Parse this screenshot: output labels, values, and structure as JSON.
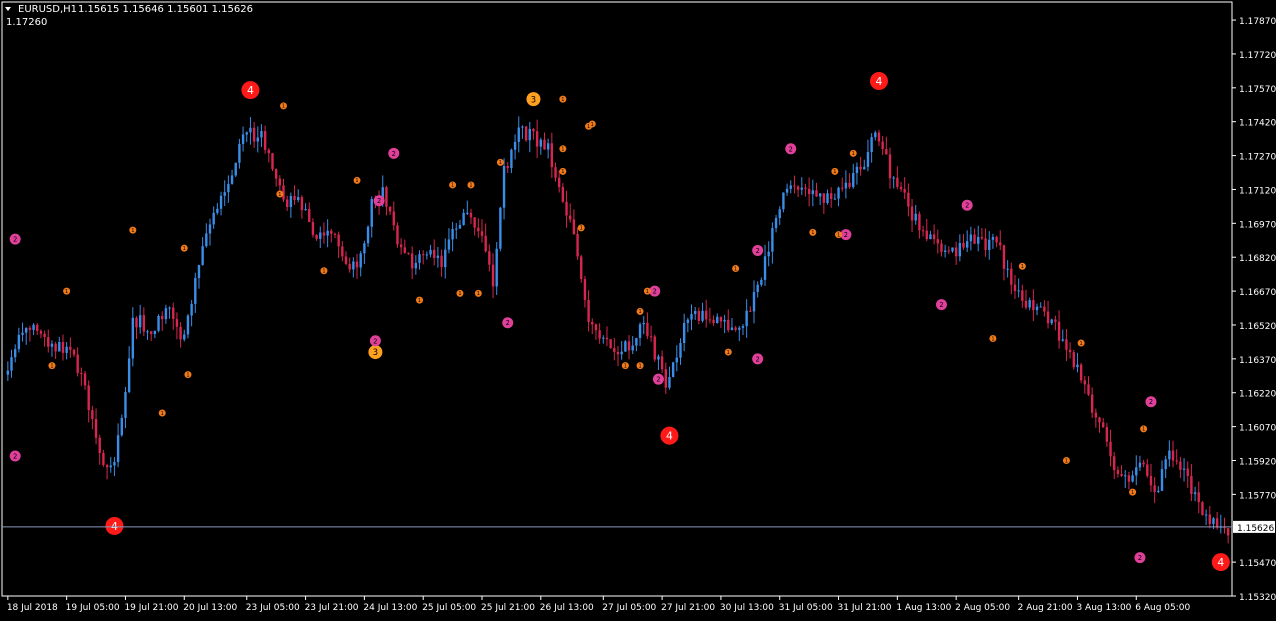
{
  "header": {
    "symbol": "EURUSD,H1",
    "ohlc": "1.15615 1.15646 1.15601 1.15626",
    "indicator_value": "1.17260",
    "menu_icon": "triangle-down-icon"
  },
  "colors": {
    "background": "#000000",
    "bull": "#3b8ee8",
    "bear": "#d7264f",
    "axis": "#ffffff",
    "bid_line": "#8899bb",
    "level4": "#ff1a1a",
    "level3": "#ffa020",
    "level2": "#e0409a",
    "level1": "#f07a1a"
  },
  "price_axis": {
    "labels": [
      "1.17870",
      "1.17720",
      "1.17570",
      "1.17420",
      "1.17270",
      "1.17120",
      "1.16970",
      "1.16820",
      "1.16670",
      "1.16520",
      "1.16370",
      "1.16220",
      "1.16070",
      "1.15920",
      "1.15770",
      "1.15626",
      "1.15470",
      "1.15320"
    ],
    "current_price": "1.15626"
  },
  "time_axis": {
    "labels": [
      "18 Jul 2018",
      "19 Jul 05:00",
      "19 Jul 21:00",
      "20 Jul 13:00",
      "23 Jul 05:00",
      "23 Jul 21:00",
      "24 Jul 13:00",
      "25 Jul 05:00",
      "25 Jul 21:00",
      "26 Jul 13:00",
      "27 Jul 05:00",
      "27 Jul 21:00",
      "30 Jul 13:00",
      "31 Jul 05:00",
      "31 Jul 21:00",
      "1 Aug 13:00",
      "2 Aug 05:00",
      "2 Aug 21:00",
      "3 Aug 13:00",
      "6 Aug 05:00"
    ]
  },
  "chart_data": {
    "type": "candlestick",
    "symbol": "EURUSD",
    "timeframe": "H1",
    "ylim": [
      1.1532,
      1.1795
    ],
    "anchors": [
      [
        0,
        1.163
      ],
      [
        5,
        1.1652
      ],
      [
        9,
        1.165
      ],
      [
        14,
        1.1642
      ],
      [
        18,
        1.1643
      ],
      [
        22,
        1.1625
      ],
      [
        26,
        1.1596
      ],
      [
        29,
        1.1587
      ],
      [
        32,
        1.161
      ],
      [
        35,
        1.1655
      ],
      [
        40,
        1.165
      ],
      [
        44,
        1.166
      ],
      [
        48,
        1.1645
      ],
      [
        52,
        1.167
      ],
      [
        56,
        1.17
      ],
      [
        60,
        1.171
      ],
      [
        63,
        1.1725
      ],
      [
        66,
        1.1737
      ],
      [
        70,
        1.1735
      ],
      [
        74,
        1.172
      ],
      [
        77,
        1.1705
      ],
      [
        80,
        1.171
      ],
      [
        83,
        1.1695
      ],
      [
        86,
        1.169
      ],
      [
        89,
        1.1692
      ],
      [
        92,
        1.1685
      ],
      [
        96,
        1.1675
      ],
      [
        100,
        1.1705
      ],
      [
        103,
        1.171
      ],
      [
        107,
        1.169
      ],
      [
        111,
        1.168
      ],
      [
        115,
        1.1683
      ],
      [
        119,
        1.168
      ],
      [
        122,
        1.1695
      ],
      [
        126,
        1.17
      ],
      [
        130,
        1.169
      ],
      [
        133,
        1.1672
      ],
      [
        136,
        1.172
      ],
      [
        140,
        1.1737
      ],
      [
        144,
        1.1735
      ],
      [
        148,
        1.173
      ],
      [
        152,
        1.171
      ],
      [
        155,
        1.169
      ],
      [
        158,
        1.166
      ],
      [
        161,
        1.165
      ],
      [
        165,
        1.1642
      ],
      [
        168,
        1.164
      ],
      [
        171,
        1.1645
      ],
      [
        174,
        1.1652
      ],
      [
        177,
        1.164
      ],
      [
        180,
        1.1626
      ],
      [
        183,
        1.164
      ],
      [
        186,
        1.1655
      ],
      [
        190,
        1.1657
      ],
      [
        194,
        1.1655
      ],
      [
        198,
        1.165
      ],
      [
        202,
        1.1655
      ],
      [
        206,
        1.1675
      ],
      [
        210,
        1.17
      ],
      [
        214,
        1.1715
      ],
      [
        218,
        1.1712
      ],
      [
        222,
        1.1707
      ],
      [
        226,
        1.171
      ],
      [
        230,
        1.1716
      ],
      [
        234,
        1.1725
      ],
      [
        237,
        1.1735
      ],
      [
        239,
        1.173
      ],
      [
        242,
        1.1715
      ],
      [
        246,
        1.1705
      ],
      [
        250,
        1.1692
      ],
      [
        254,
        1.1688
      ],
      [
        258,
        1.1683
      ],
      [
        262,
        1.169
      ],
      [
        266,
        1.1688
      ],
      [
        270,
        1.169
      ],
      [
        274,
        1.167
      ],
      [
        278,
        1.166
      ],
      [
        282,
        1.1662
      ],
      [
        286,
        1.165
      ],
      [
        290,
        1.164
      ],
      [
        293,
        1.163
      ],
      [
        296,
        1.1615
      ],
      [
        299,
        1.1605
      ],
      [
        302,
        1.1585
      ],
      [
        306,
        1.1585
      ],
      [
        310,
        1.159
      ],
      [
        313,
        1.1575
      ],
      [
        316,
        1.1595
      ],
      [
        320,
        1.159
      ],
      [
        324,
        1.1575
      ],
      [
        327,
        1.1565
      ],
      [
        330,
        1.1562
      ]
    ],
    "markers": [
      {
        "label": "4",
        "level": 4,
        "bar": 29,
        "price": 1.1563
      },
      {
        "label": "4",
        "level": 4,
        "bar": 66,
        "price": 1.1756
      },
      {
        "label": "4",
        "level": 4,
        "bar": 180,
        "price": 1.1603
      },
      {
        "label": "4",
        "level": 4,
        "bar": 237,
        "price": 1.176
      },
      {
        "label": "4",
        "level": 4,
        "bar": 330,
        "price": 1.1547
      },
      {
        "label": "3",
        "level": 3,
        "bar": 100,
        "price": 1.164
      },
      {
        "label": "3",
        "level": 3,
        "bar": 143,
        "price": 1.1752
      },
      {
        "label": "2",
        "level": 2,
        "bar": 2,
        "price": 1.169
      },
      {
        "label": "2",
        "level": 2,
        "bar": 2,
        "price": 1.1594
      },
      {
        "label": "2",
        "level": 2,
        "bar": 105,
        "price": 1.1728
      },
      {
        "label": "2",
        "level": 2,
        "bar": 101,
        "price": 1.1707
      },
      {
        "label": "2",
        "level": 2,
        "bar": 100,
        "price": 1.1645
      },
      {
        "label": "2",
        "level": 2,
        "bar": 136,
        "price": 1.1653
      },
      {
        "label": "2",
        "level": 2,
        "bar": 176,
        "price": 1.1667
      },
      {
        "label": "2",
        "level": 2,
        "bar": 177,
        "price": 1.1628
      },
      {
        "label": "2",
        "level": 2,
        "bar": 204,
        "price": 1.1685
      },
      {
        "label": "2",
        "level": 2,
        "bar": 204,
        "price": 1.1637
      },
      {
        "label": "2",
        "level": 2,
        "bar": 213,
        "price": 1.173
      },
      {
        "label": "2",
        "level": 2,
        "bar": 228,
        "price": 1.1692
      },
      {
        "label": "2",
        "level": 2,
        "bar": 261,
        "price": 1.1705
      },
      {
        "label": "2",
        "level": 2,
        "bar": 254,
        "price": 1.1661
      },
      {
        "label": "2",
        "level": 2,
        "bar": 311,
        "price": 1.1618
      },
      {
        "label": "2",
        "level": 2,
        "bar": 308,
        "price": 1.1549
      },
      {
        "label": "1",
        "level": 1,
        "bar": 75,
        "price": 1.1749
      },
      {
        "label": "1",
        "level": 1,
        "bar": 151,
        "price": 1.1752
      },
      {
        "label": "1",
        "level": 1,
        "bar": 158,
        "price": 1.174
      },
      {
        "label": "1",
        "level": 1,
        "bar": 16,
        "price": 1.1667
      },
      {
        "label": "1",
        "level": 1,
        "bar": 12,
        "price": 1.1634
      },
      {
        "label": "1",
        "level": 1,
        "bar": 34,
        "price": 1.1694
      },
      {
        "label": "1",
        "level": 1,
        "bar": 48,
        "price": 1.1686
      },
      {
        "label": "1",
        "level": 1,
        "bar": 49,
        "price": 1.163
      },
      {
        "label": "1",
        "level": 1,
        "bar": 42,
        "price": 1.1613
      },
      {
        "label": "1",
        "level": 1,
        "bar": 74,
        "price": 1.171
      },
      {
        "label": "1",
        "level": 1,
        "bar": 95,
        "price": 1.1716
      },
      {
        "label": "1",
        "level": 1,
        "bar": 86,
        "price": 1.1676
      },
      {
        "label": "1",
        "level": 1,
        "bar": 112,
        "price": 1.1663
      },
      {
        "label": "1",
        "level": 1,
        "bar": 121,
        "price": 1.1714
      },
      {
        "label": "1",
        "level": 1,
        "bar": 126,
        "price": 1.1714
      },
      {
        "label": "1",
        "level": 1,
        "bar": 123,
        "price": 1.1666
      },
      {
        "label": "1",
        "level": 1,
        "bar": 128,
        "price": 1.1666
      },
      {
        "label": "1",
        "level": 1,
        "bar": 134,
        "price": 1.1724
      },
      {
        "label": "1",
        "level": 1,
        "bar": 151,
        "price": 1.173
      },
      {
        "label": "1",
        "level": 1,
        "bar": 151,
        "price": 1.172
      },
      {
        "label": "1",
        "level": 1,
        "bar": 159,
        "price": 1.1741
      },
      {
        "label": "1",
        "level": 1,
        "bar": 156,
        "price": 1.1695
      },
      {
        "label": "1",
        "level": 1,
        "bar": 174,
        "price": 1.1667
      },
      {
        "label": "1",
        "level": 1,
        "bar": 172,
        "price": 1.1658
      },
      {
        "label": "1",
        "level": 1,
        "bar": 168,
        "price": 1.1634
      },
      {
        "label": "1",
        "level": 1,
        "bar": 172,
        "price": 1.1634
      },
      {
        "label": "1",
        "level": 1,
        "bar": 198,
        "price": 1.1677
      },
      {
        "label": "1",
        "level": 1,
        "bar": 196,
        "price": 1.164
      },
      {
        "label": "1",
        "level": 1,
        "bar": 219,
        "price": 1.1693
      },
      {
        "label": "1",
        "level": 1,
        "bar": 225,
        "price": 1.172
      },
      {
        "label": "1",
        "level": 1,
        "bar": 226,
        "price": 1.1692
      },
      {
        "label": "1",
        "level": 1,
        "bar": 230,
        "price": 1.1728
      },
      {
        "label": "1",
        "level": 1,
        "bar": 276,
        "price": 1.1678
      },
      {
        "label": "1",
        "level": 1,
        "bar": 268,
        "price": 1.1646
      },
      {
        "label": "1",
        "level": 1,
        "bar": 292,
        "price": 1.1644
      },
      {
        "label": "1",
        "level": 1,
        "bar": 288,
        "price": 1.1592
      },
      {
        "label": "1",
        "level": 1,
        "bar": 309,
        "price": 1.1606
      },
      {
        "label": "1",
        "level": 1,
        "bar": 306,
        "price": 1.1578
      }
    ]
  }
}
